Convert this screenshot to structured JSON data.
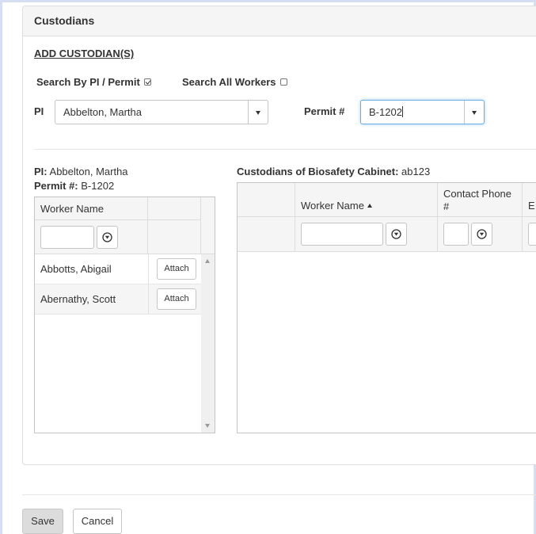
{
  "panel": {
    "title": "Custodians",
    "add_link": "ADD CUSTODIAN(S)"
  },
  "search": {
    "by_pi_permit_label": "Search By PI / Permit",
    "by_pi_permit_checked": true,
    "all_workers_label": "Search All Workers",
    "all_workers_checked": false
  },
  "pi_field": {
    "label": "PI",
    "value": "Abbelton, Martha"
  },
  "permit_field": {
    "label": "Permit #",
    "value": "B-1202"
  },
  "selection_info": {
    "pi_label": "PI:",
    "pi_value": "Abbelton, Martha",
    "permit_label": "Permit #:",
    "permit_value": "B-1202"
  },
  "workers_grid": {
    "header": "Worker Name",
    "attach_label": "Attach",
    "rows": [
      {
        "name": "Abbotts, Abigail"
      },
      {
        "name": "Abernathy, Scott"
      }
    ]
  },
  "custodians_grid": {
    "title_label": "Custodians of Biosafety Cabinet:",
    "cabinet_id": "ab123",
    "columns": [
      "Worker Name",
      "Contact Phone #",
      "E"
    ]
  },
  "footer": {
    "save_label": "Save",
    "cancel_label": "Cancel"
  }
}
